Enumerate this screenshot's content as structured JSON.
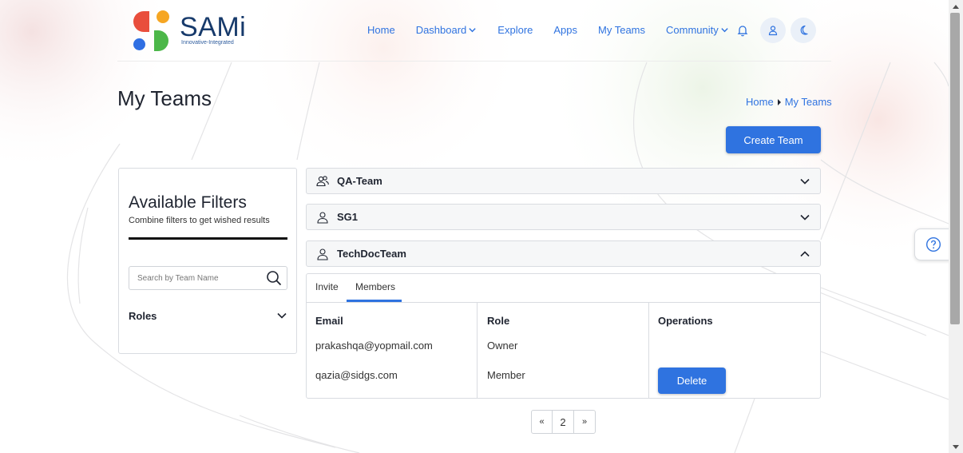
{
  "brand": {
    "name": "SAMi",
    "tagline": "Innovative-Integrated"
  },
  "nav": {
    "items": [
      {
        "label": "Home"
      },
      {
        "label": "Dashboard",
        "dropdown": true
      },
      {
        "label": "Explore"
      },
      {
        "label": "Apps"
      },
      {
        "label": "My Teams"
      },
      {
        "label": "Community",
        "dropdown": true
      }
    ]
  },
  "page": {
    "title": "My Teams",
    "breadcrumb": [
      "Home",
      "My Teams"
    ],
    "create_label": "Create Team"
  },
  "filters": {
    "title": "Available Filters",
    "subtitle": "Combine filters to get wished results",
    "search_placeholder": "Search by Team Name",
    "roles_label": "Roles"
  },
  "teams": [
    {
      "name": "QA-Team",
      "icon": "users-icon",
      "expanded": false
    },
    {
      "name": "SG1",
      "icon": "user-icon",
      "expanded": false
    },
    {
      "name": "TechDocTeam",
      "icon": "user-icon",
      "expanded": true
    }
  ],
  "team_panel": {
    "tabs": [
      {
        "label": "Invite",
        "active": false
      },
      {
        "label": "Members",
        "active": true
      }
    ],
    "columns": [
      "Email",
      "Role",
      "Operations"
    ],
    "rows": [
      {
        "email": "prakashqa@yopmail.com",
        "role": "Owner",
        "operation": ""
      },
      {
        "email": "qazia@sidgs.com",
        "role": "Member",
        "operation": "Delete"
      }
    ]
  },
  "pagination": {
    "prev": "«",
    "current": "2",
    "next": "»"
  },
  "colors": {
    "accent": "#2f73e0",
    "brand_navy": "#173a6b",
    "logo_red": "#e94e3c",
    "logo_orange": "#f6a623",
    "logo_blue": "#2f6fe3",
    "logo_green": "#4cb749"
  }
}
